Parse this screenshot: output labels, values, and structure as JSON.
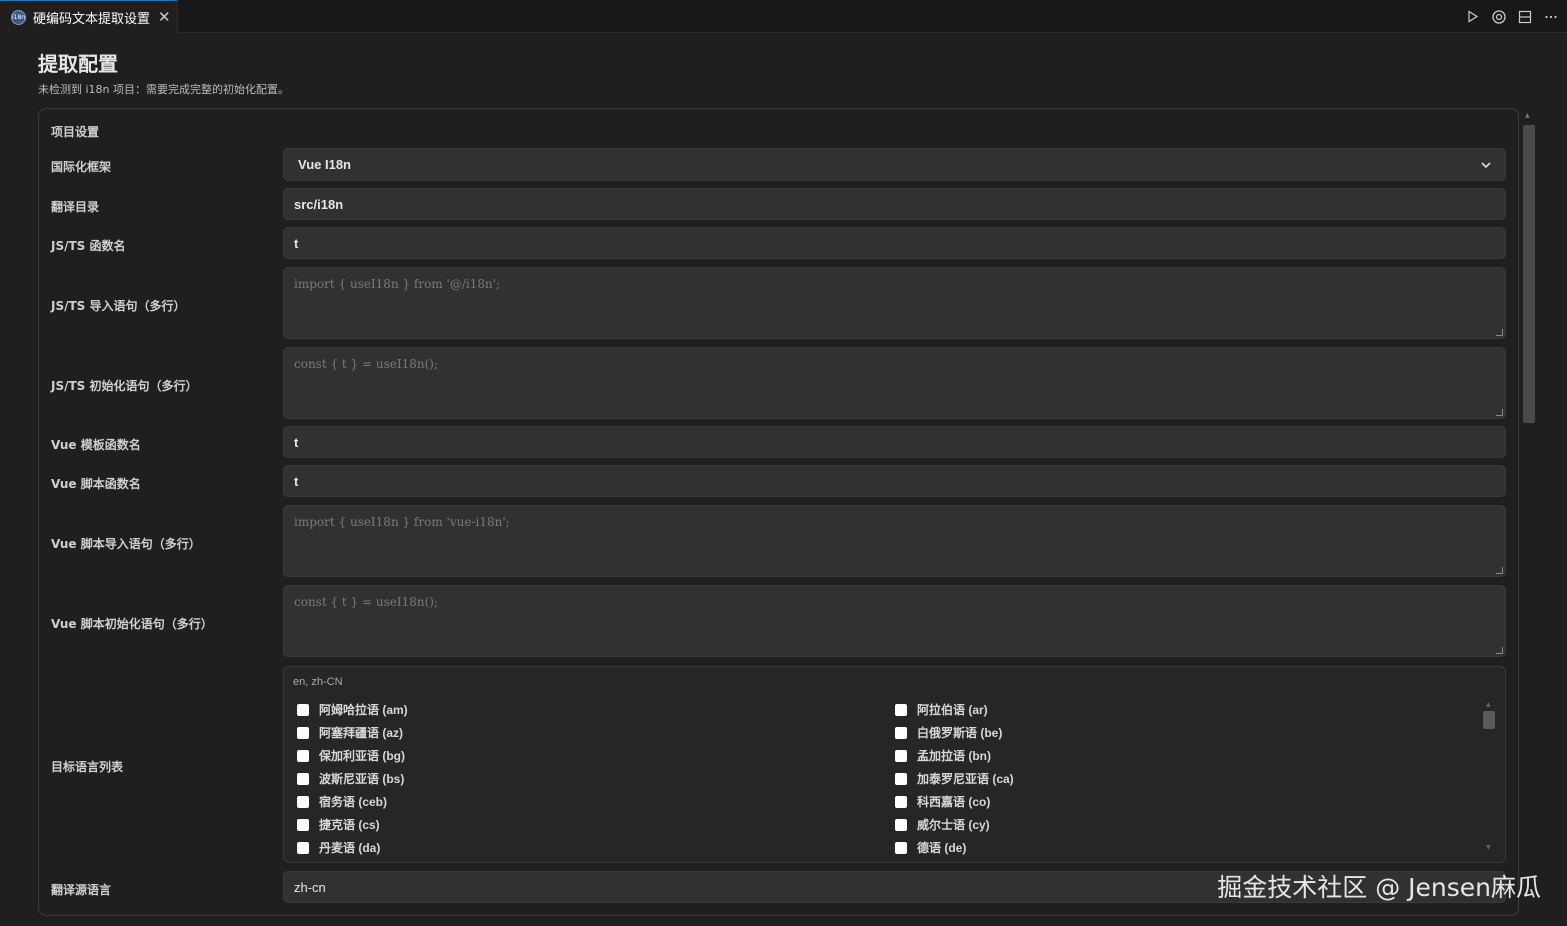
{
  "tab": {
    "title": "硬编码文本提取设置",
    "icon_label": "i18n",
    "close_glyph": "✕"
  },
  "toolbar": {
    "run_icon": "play-icon",
    "ai_icon": "openai-icon",
    "split_icon": "split-editor-icon",
    "more_icon": "more-icon"
  },
  "page": {
    "title": "提取配置",
    "subtitle": "未检测到 i18n 项目：需要完成完整的初始化配置。"
  },
  "section": {
    "title": "项目设置"
  },
  "fields": {
    "framework": {
      "label": "国际化框架",
      "value": "Vue I18n"
    },
    "translate_dir": {
      "label": "翻译目录",
      "value": "src/i18n"
    },
    "js_func": {
      "label": "JS/TS 函数名",
      "value": "t"
    },
    "js_import": {
      "label": "JS/TS 导入语句（多行）",
      "placeholder": "import { useI18n } from '@/i18n';"
    },
    "js_init": {
      "label": "JS/TS 初始化语句（多行）",
      "placeholder": "const { t } = useI18n();"
    },
    "vue_template_func": {
      "label": "Vue 模板函数名",
      "value": "t"
    },
    "vue_script_func": {
      "label": "Vue 脚本函数名",
      "value": "t"
    },
    "vue_import": {
      "label": "Vue 脚本导入语句（多行）",
      "placeholder": "import { useI18n } from 'vue-i18n';"
    },
    "vue_init": {
      "label": "Vue 脚本初始化语句（多行）",
      "placeholder": "const { t } = useI18n();"
    },
    "target_langs": {
      "label": "目标语言列表",
      "selected": "en, zh-CN",
      "left": [
        "阿姆哈拉语 (am)",
        "阿塞拜疆语 (az)",
        "保加利亚语 (bg)",
        "波斯尼亚语 (bs)",
        "宿务语 (ceb)",
        "捷克语 (cs)",
        "丹麦语 (da)"
      ],
      "right": [
        "阿拉伯语 (ar)",
        "白俄罗斯语 (be)",
        "孟加拉语 (bn)",
        "加泰罗尼亚语 (ca)",
        "科西嘉语 (co)",
        "威尔士语 (cy)",
        "德语 (de)"
      ]
    },
    "source_lang": {
      "label": "翻译源语言",
      "value": "zh-cn"
    }
  },
  "watermark": "掘金技术社区 @ Jensen麻瓜"
}
